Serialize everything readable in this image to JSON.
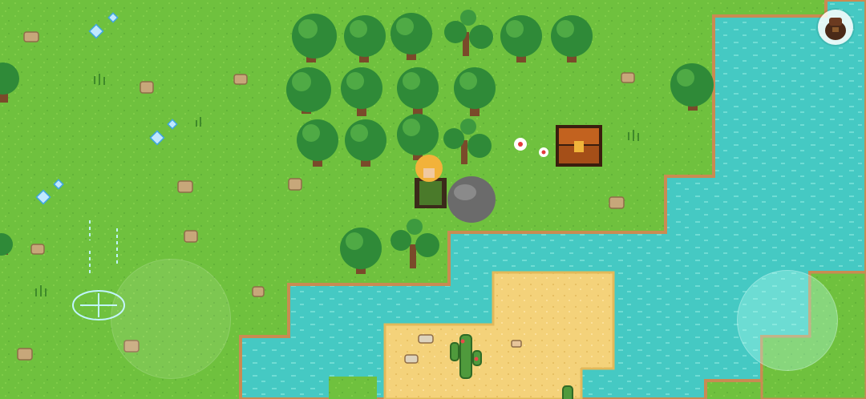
{
  "game": {
    "scene": "overworld-forest-river",
    "hud": {
      "inventory_button_icon": "bag-icon",
      "move_joystick_icon": "joystick-base",
      "action_joystick_icon": "action-button",
      "waypoint_icon": "waypoint-marker-icon"
    },
    "player": {
      "icon": "adventurer-sprite"
    },
    "objects": {
      "chest_icon": "treasure-chest-icon",
      "rock_icon": "boulder-icon",
      "cactus_icon": "cactus-icon",
      "tree_icon": "oak-tree-icon",
      "flower_icon": "flower-icon"
    },
    "colors": {
      "grass": "#6fc13e",
      "grass_dark": "#5aa632",
      "water": "#45c9c3",
      "water_light": "#7fe6dc",
      "sand": "#f4d27a",
      "shore": "#c98b52",
      "tree_dark": "#1f6b2c",
      "tree_mid": "#2f8a38",
      "tree_light": "#4faa45",
      "chest": "#c2621f"
    }
  }
}
